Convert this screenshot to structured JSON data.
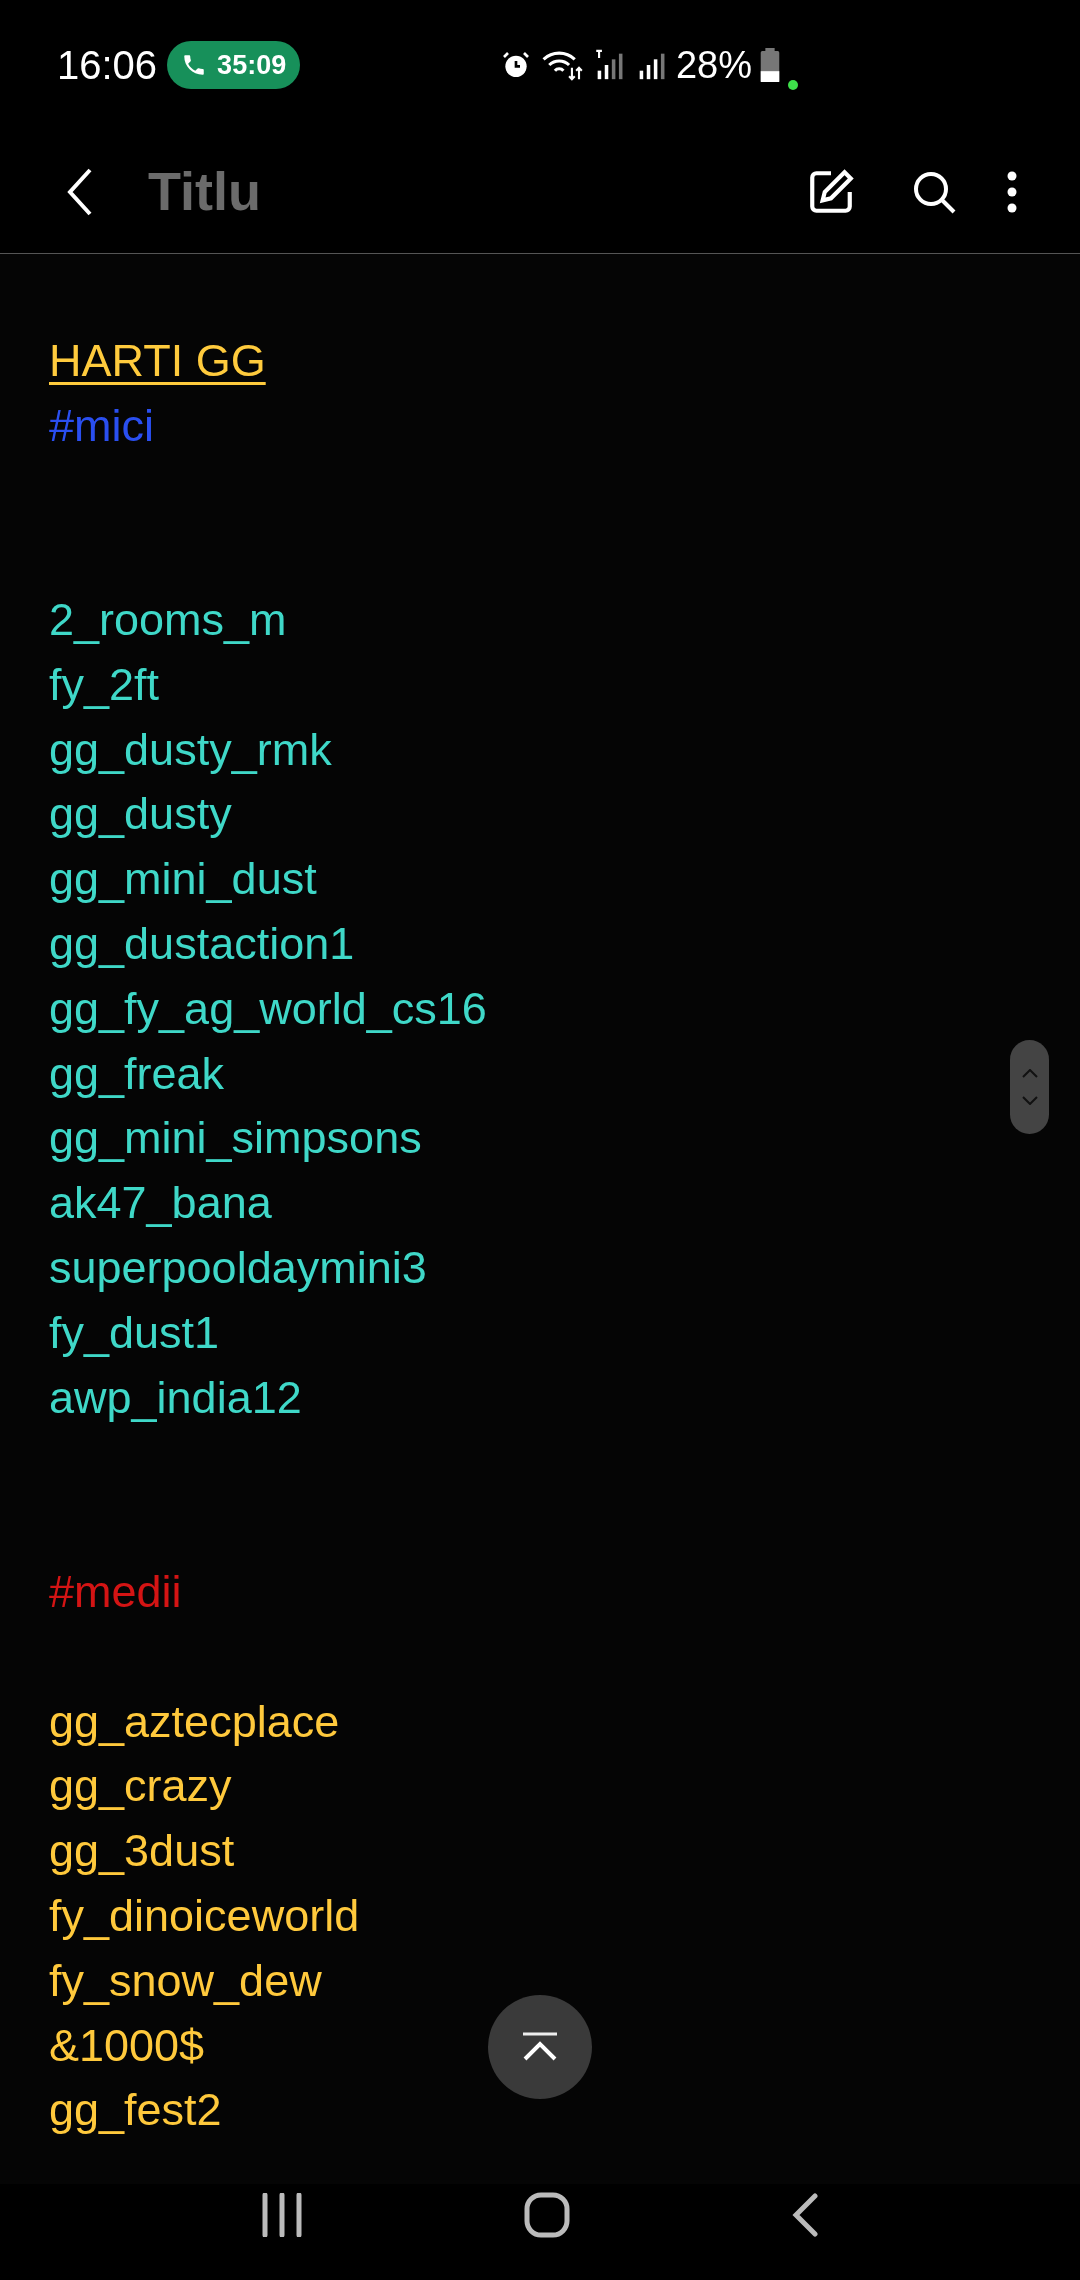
{
  "status_bar": {
    "time": "16:06",
    "call_timer": "35:09",
    "battery": "28%"
  },
  "header": {
    "title": "Titlu"
  },
  "note_lines": [
    {
      "kind": "blank"
    },
    {
      "kind": "heading",
      "text": "HARTI GG",
      "color": "#ffcb3d"
    },
    {
      "kind": "tag",
      "text": "#mici",
      "color": "#2a4ff0"
    },
    {
      "kind": "blank"
    },
    {
      "kind": "blank"
    },
    {
      "kind": "item",
      "text": "2_rooms_m",
      "color": "#3fd8c8"
    },
    {
      "kind": "item",
      "text": "fy_2ft",
      "color": "#3fd8c8"
    },
    {
      "kind": "item",
      "text": "gg_dusty_rmk",
      "color": "#3fd8c8"
    },
    {
      "kind": "item",
      "text": "gg_dusty",
      "color": "#3fd8c8"
    },
    {
      "kind": "item",
      "text": "gg_mini_dust",
      "color": "#3fd8c8"
    },
    {
      "kind": "item",
      "text": "gg_dustaction1",
      "color": "#3fd8c8"
    },
    {
      "kind": "item",
      "text": "gg_fy_ag_world_cs16",
      "color": "#3fd8c8"
    },
    {
      "kind": "item",
      "text": "gg_freak",
      "color": "#3fd8c8"
    },
    {
      "kind": "item",
      "text": "gg_mini_simpsons",
      "color": "#3fd8c8"
    },
    {
      "kind": "item",
      "text": "ak47_bana",
      "color": "#3fd8c8"
    },
    {
      "kind": "item",
      "text": "superpooldaymini3",
      "color": "#3fd8c8"
    },
    {
      "kind": "item",
      "text": "fy_dust1",
      "color": "#3fd8c8"
    },
    {
      "kind": "item",
      "text": "awp_india12",
      "color": "#3fd8c8"
    },
    {
      "kind": "blank"
    },
    {
      "kind": "blank"
    },
    {
      "kind": "tag",
      "text": "#medii",
      "color": "#d41414"
    },
    {
      "kind": "blank"
    },
    {
      "kind": "item",
      "text": "gg_aztecplace",
      "color": "#ffc93c"
    },
    {
      "kind": "item",
      "text": "gg_crazy",
      "color": "#ffc93c"
    },
    {
      "kind": "item",
      "text": "gg_3dust",
      "color": "#ffc93c"
    },
    {
      "kind": "item",
      "text": "fy_dinoiceworld",
      "color": "#ffc93c"
    },
    {
      "kind": "item",
      "text": "fy_snow_dew",
      "color": "#ffc93c"
    },
    {
      "kind": "item",
      "text": "&1000$",
      "color": "#ffc93c"
    },
    {
      "kind": "item",
      "text": "gg_fest2",
      "color": "#ffc93c"
    }
  ]
}
